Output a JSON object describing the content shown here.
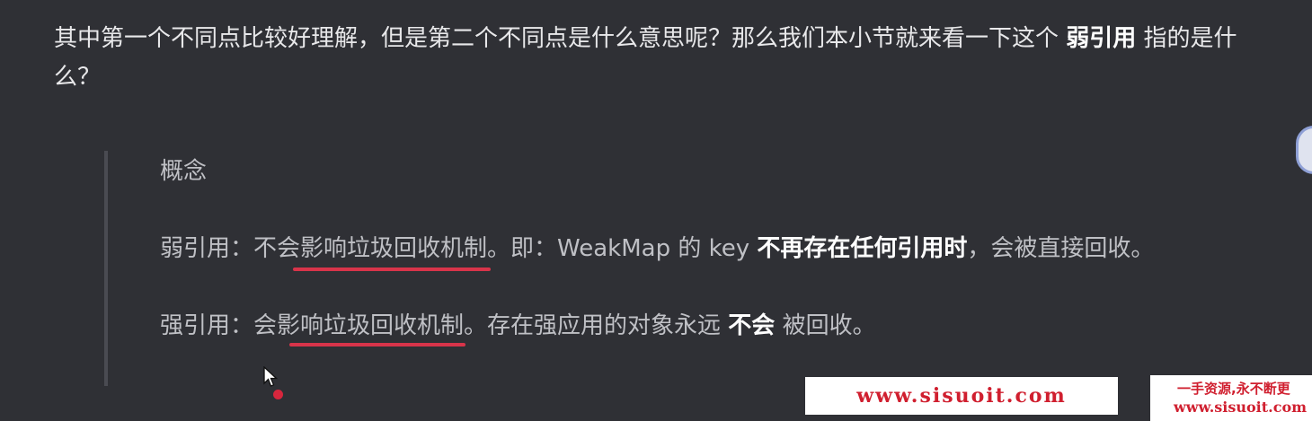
{
  "intro": {
    "text": "其中第一个不同点比较好理解，但是第二个不同点是什么意思呢？那么我们本小节就来看一下这个 ",
    "bold": "弱引用",
    "tail": " 指的是什么？"
  },
  "quote": {
    "title": "概念",
    "weak": {
      "label": "弱引用：",
      "underlined": "不会影响垃圾回收机制",
      "middle": "。即：WeakMap 的 key ",
      "bold": "不再存在任何引用时",
      "tail": "，会被直接回收。"
    },
    "strong": {
      "label": "强引用：",
      "underlined": "会影响垃圾回收机制",
      "middle": "。存在强应用的对象永远 ",
      "bold": "不会",
      "tail": " 被回收。"
    }
  },
  "watermark": {
    "site": "www.sisuoit.com",
    "slogan": "一手资源,永不断更",
    "site_small": "www.sisuoit.com"
  },
  "colors": {
    "background": "#2f3035",
    "underline": "#d8344a",
    "watermark_text": "#d01f2f"
  }
}
